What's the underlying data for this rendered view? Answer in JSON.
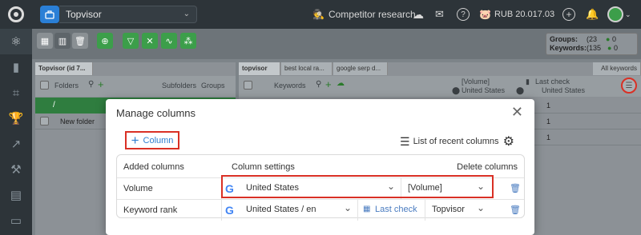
{
  "topbar": {
    "project_name": "Topvisor",
    "competitor_label": "Competitor research",
    "balance": "RUB 20.017.03"
  },
  "stats": {
    "groups_label": "Groups:",
    "groups_value": "(23",
    "groups_active": "0",
    "keywords_label": "Keywords:",
    "keywords_value": "(135",
    "keywords_active": "0"
  },
  "left_panel": {
    "tab": "Topvisor (id 7...",
    "folders_label": "Folders",
    "subfolders_label": "Subfolders",
    "groups_label": "Groups",
    "root_label": "/",
    "new_folder": "New folder"
  },
  "right_panel": {
    "tabs": [
      "topvisor",
      "best local ra...",
      "google serp d..."
    ],
    "all_keywords": "All keywords",
    "keywords_label": "Keywords",
    "col1_title": "[Volume]",
    "col1_region": "United States",
    "col2_title": "Last check",
    "col2_region": "United States",
    "values": [
      "1",
      "1",
      "1"
    ]
  },
  "modal": {
    "title": "Manage columns",
    "add_column": "Column",
    "recent_columns": "List of recent columns",
    "headers": {
      "added": "Added columns",
      "settings": "Column settings",
      "delete": "Delete columns"
    },
    "rows": [
      {
        "name": "Volume",
        "region": "United States",
        "param": "[Volume]"
      },
      {
        "name": "Keyword rank",
        "region": "United States / en",
        "date": "Last check",
        "param": "Topvisor"
      }
    ]
  },
  "colors": {
    "accent_red": "#d93025",
    "link_blue": "#2f7fd0",
    "toolbar_green": "#3c9e4a",
    "project_blue": "#2a7fd6"
  }
}
